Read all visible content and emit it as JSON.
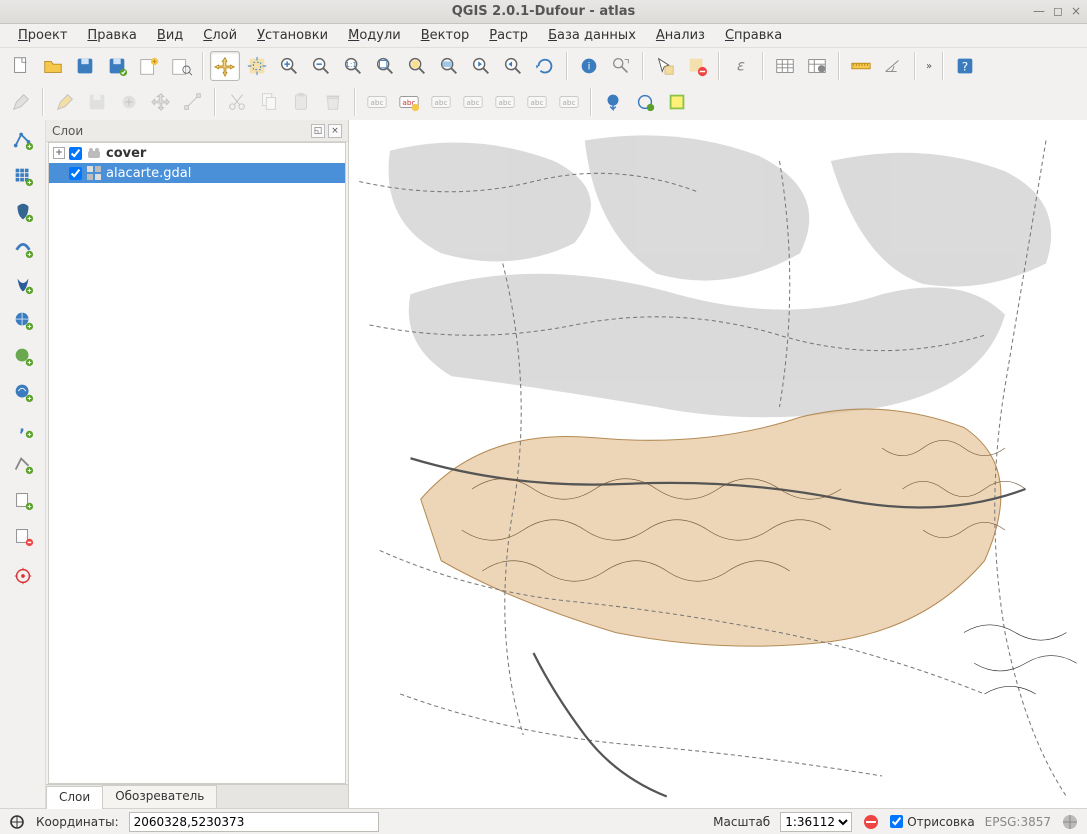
{
  "window": {
    "title": "QGIS 2.0.1-Dufour - atlas"
  },
  "menu": {
    "items": [
      "Проект",
      "Правка",
      "Вид",
      "Слой",
      "Установки",
      "Модули",
      "Вектор",
      "Растр",
      "База данных",
      "Анализ",
      "Справка"
    ]
  },
  "panel": {
    "title": "Слои",
    "tabs": {
      "layers": "Слои",
      "browser": "Обозреватель"
    }
  },
  "layers": [
    {
      "name": "cover",
      "checked": true,
      "expandable": true,
      "type": "vector",
      "selected": false
    },
    {
      "name": "alacarte.gdal",
      "checked": true,
      "expandable": false,
      "type": "raster",
      "selected": true
    }
  ],
  "statusbar": {
    "coord_label": "Координаты:",
    "coord_value": "2060328,5230373",
    "scale_label": "Масштаб",
    "scale_value": "1:36112",
    "render_label": "Отрисовка",
    "render_checked": true,
    "crs": "EPSG:3857"
  },
  "toolbar1_icons": [
    "new-project",
    "open-project",
    "save-project",
    "save-project-as",
    "new-composer",
    "composer-manager",
    "sep",
    "pan",
    "pan-selection",
    "zoom-in",
    "zoom-out",
    "zoom-native",
    "zoom-full",
    "zoom-selection",
    "zoom-layer",
    "zoom-last",
    "zoom-next",
    "refresh",
    "sep",
    "identify",
    "identify-results",
    "sep",
    "select",
    "deselect",
    "sep",
    "expression",
    "sep",
    "open-table",
    "field-calc",
    "sep",
    "measure",
    "measure-angle",
    "sep",
    "overflow",
    "sep",
    "help"
  ],
  "toolbar2_icons": [
    "edit-toggle",
    "sep",
    "edit-pencil",
    "save-edits",
    "add-feature",
    "move-feature",
    "node-tool",
    "sep",
    "cut",
    "copy",
    "paste",
    "delete",
    "sep",
    "label-layer",
    "label-pin",
    "label-highlight",
    "label-show",
    "label-move",
    "label-rotate",
    "label-change",
    "sep",
    "osm-download",
    "osm-import",
    "osm-settings"
  ],
  "left_toolbar_icons": [
    "add-vector",
    "add-raster",
    "add-postgis",
    "add-spatialite",
    "add-mssql",
    "add-wms",
    "add-wcs",
    "add-wfs",
    "add-delimited",
    "add-gpx",
    "new-shapefile",
    "remove-layer",
    "sep",
    "gps"
  ]
}
